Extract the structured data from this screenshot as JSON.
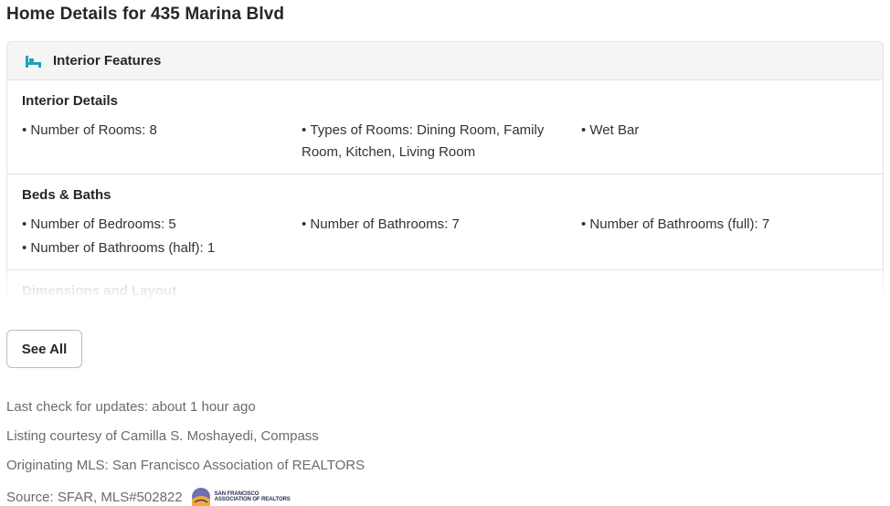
{
  "page": {
    "title": "Home Details for 435 Marina Blvd"
  },
  "panel": {
    "header_label": "Interior Features",
    "icon": "bed-icon",
    "accent_color": "#1aa3b4",
    "sections": [
      {
        "title": "Interior Details",
        "items": [
          "Number of Rooms: 8",
          "Types of Rooms: Dining Room, Family Room, Kitchen, Living Room",
          "Wet Bar"
        ]
      },
      {
        "title": "Beds & Baths",
        "items": [
          "Number of Bedrooms: 5",
          "Number of Bathrooms: 7",
          "Number of Bathrooms (full): 7",
          "Number of Bathrooms (half): 1"
        ]
      },
      {
        "title": "Dimensions and Layout",
        "items": []
      }
    ]
  },
  "see_all_label": "See All",
  "meta": {
    "last_check": "Last check for updates: about 1 hour ago",
    "listing_courtesy": "Listing courtesy of Camilla S. Moshayedi, Compass",
    "originating_mls": "Originating MLS: San Francisco Association of REALTORS",
    "source": "Source: SFAR, MLS#502822",
    "logo_text_line1": "San Francisco",
    "logo_text_line2": "Association of Realtors"
  }
}
